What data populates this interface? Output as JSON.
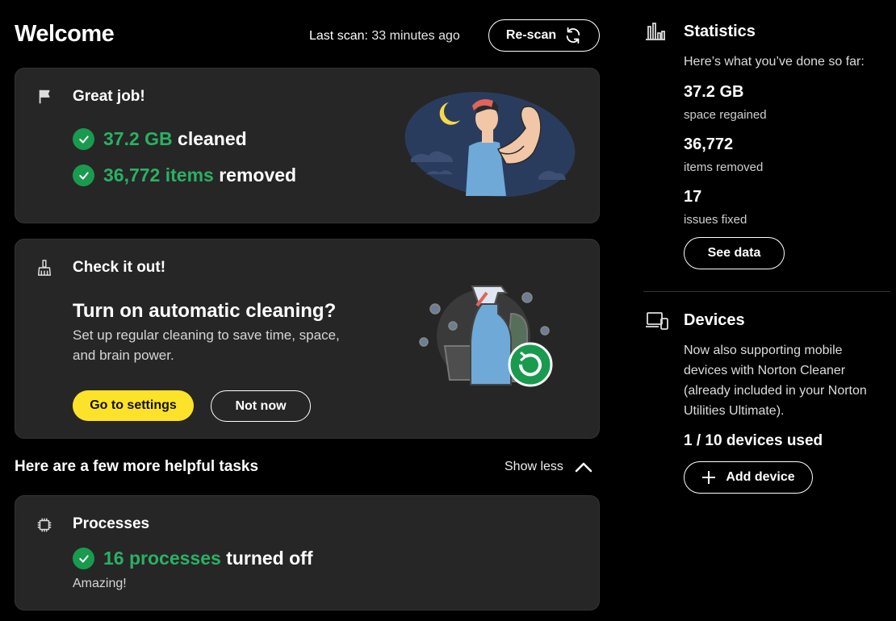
{
  "header": {
    "title": "Welcome",
    "last_scan_key": "Last scan:",
    "last_scan_value": "33 minutes ago",
    "rescan_label": "Re-scan"
  },
  "results_card": {
    "title": "Great job!",
    "items": [
      {
        "highlight": "37.2 GB",
        "text": "cleaned"
      },
      {
        "highlight": "36,772 items",
        "text": "removed"
      }
    ]
  },
  "promo_card": {
    "title": "Check it out!",
    "question": "Turn on automatic cleaning?",
    "description_line1": "Set up regular cleaning to save time, space,",
    "description_line2": "and brain power.",
    "primary_button": "Go to settings",
    "secondary_button": "Not now"
  },
  "tasks": {
    "heading": "Here are a few more helpful tasks",
    "toggle_label": "Show less"
  },
  "processes_card": {
    "title": "Processes",
    "highlight": "16 processes",
    "text": "turned off",
    "note": "Amazing!"
  },
  "statistics": {
    "title": "Statistics",
    "intro": "Here’s what you’ve done so far:",
    "items": [
      {
        "value": "37.2 GB",
        "label": "space regained"
      },
      {
        "value": "36,772",
        "label": "items removed"
      },
      {
        "value": "17",
        "label": "issues fixed"
      }
    ],
    "button": "See data"
  },
  "devices": {
    "title": "Devices",
    "text_lines": [
      "Now also supporting mobile",
      "devices with Norton Cleaner",
      "(already included in your Norton",
      "Utilities Ultimate)."
    ],
    "used": "1 / 10 devices used",
    "button": "Add device"
  },
  "colors": {
    "accent_green": "#2bb063",
    "accent_yellow": "#fde22a",
    "card_bg": "#262626"
  }
}
